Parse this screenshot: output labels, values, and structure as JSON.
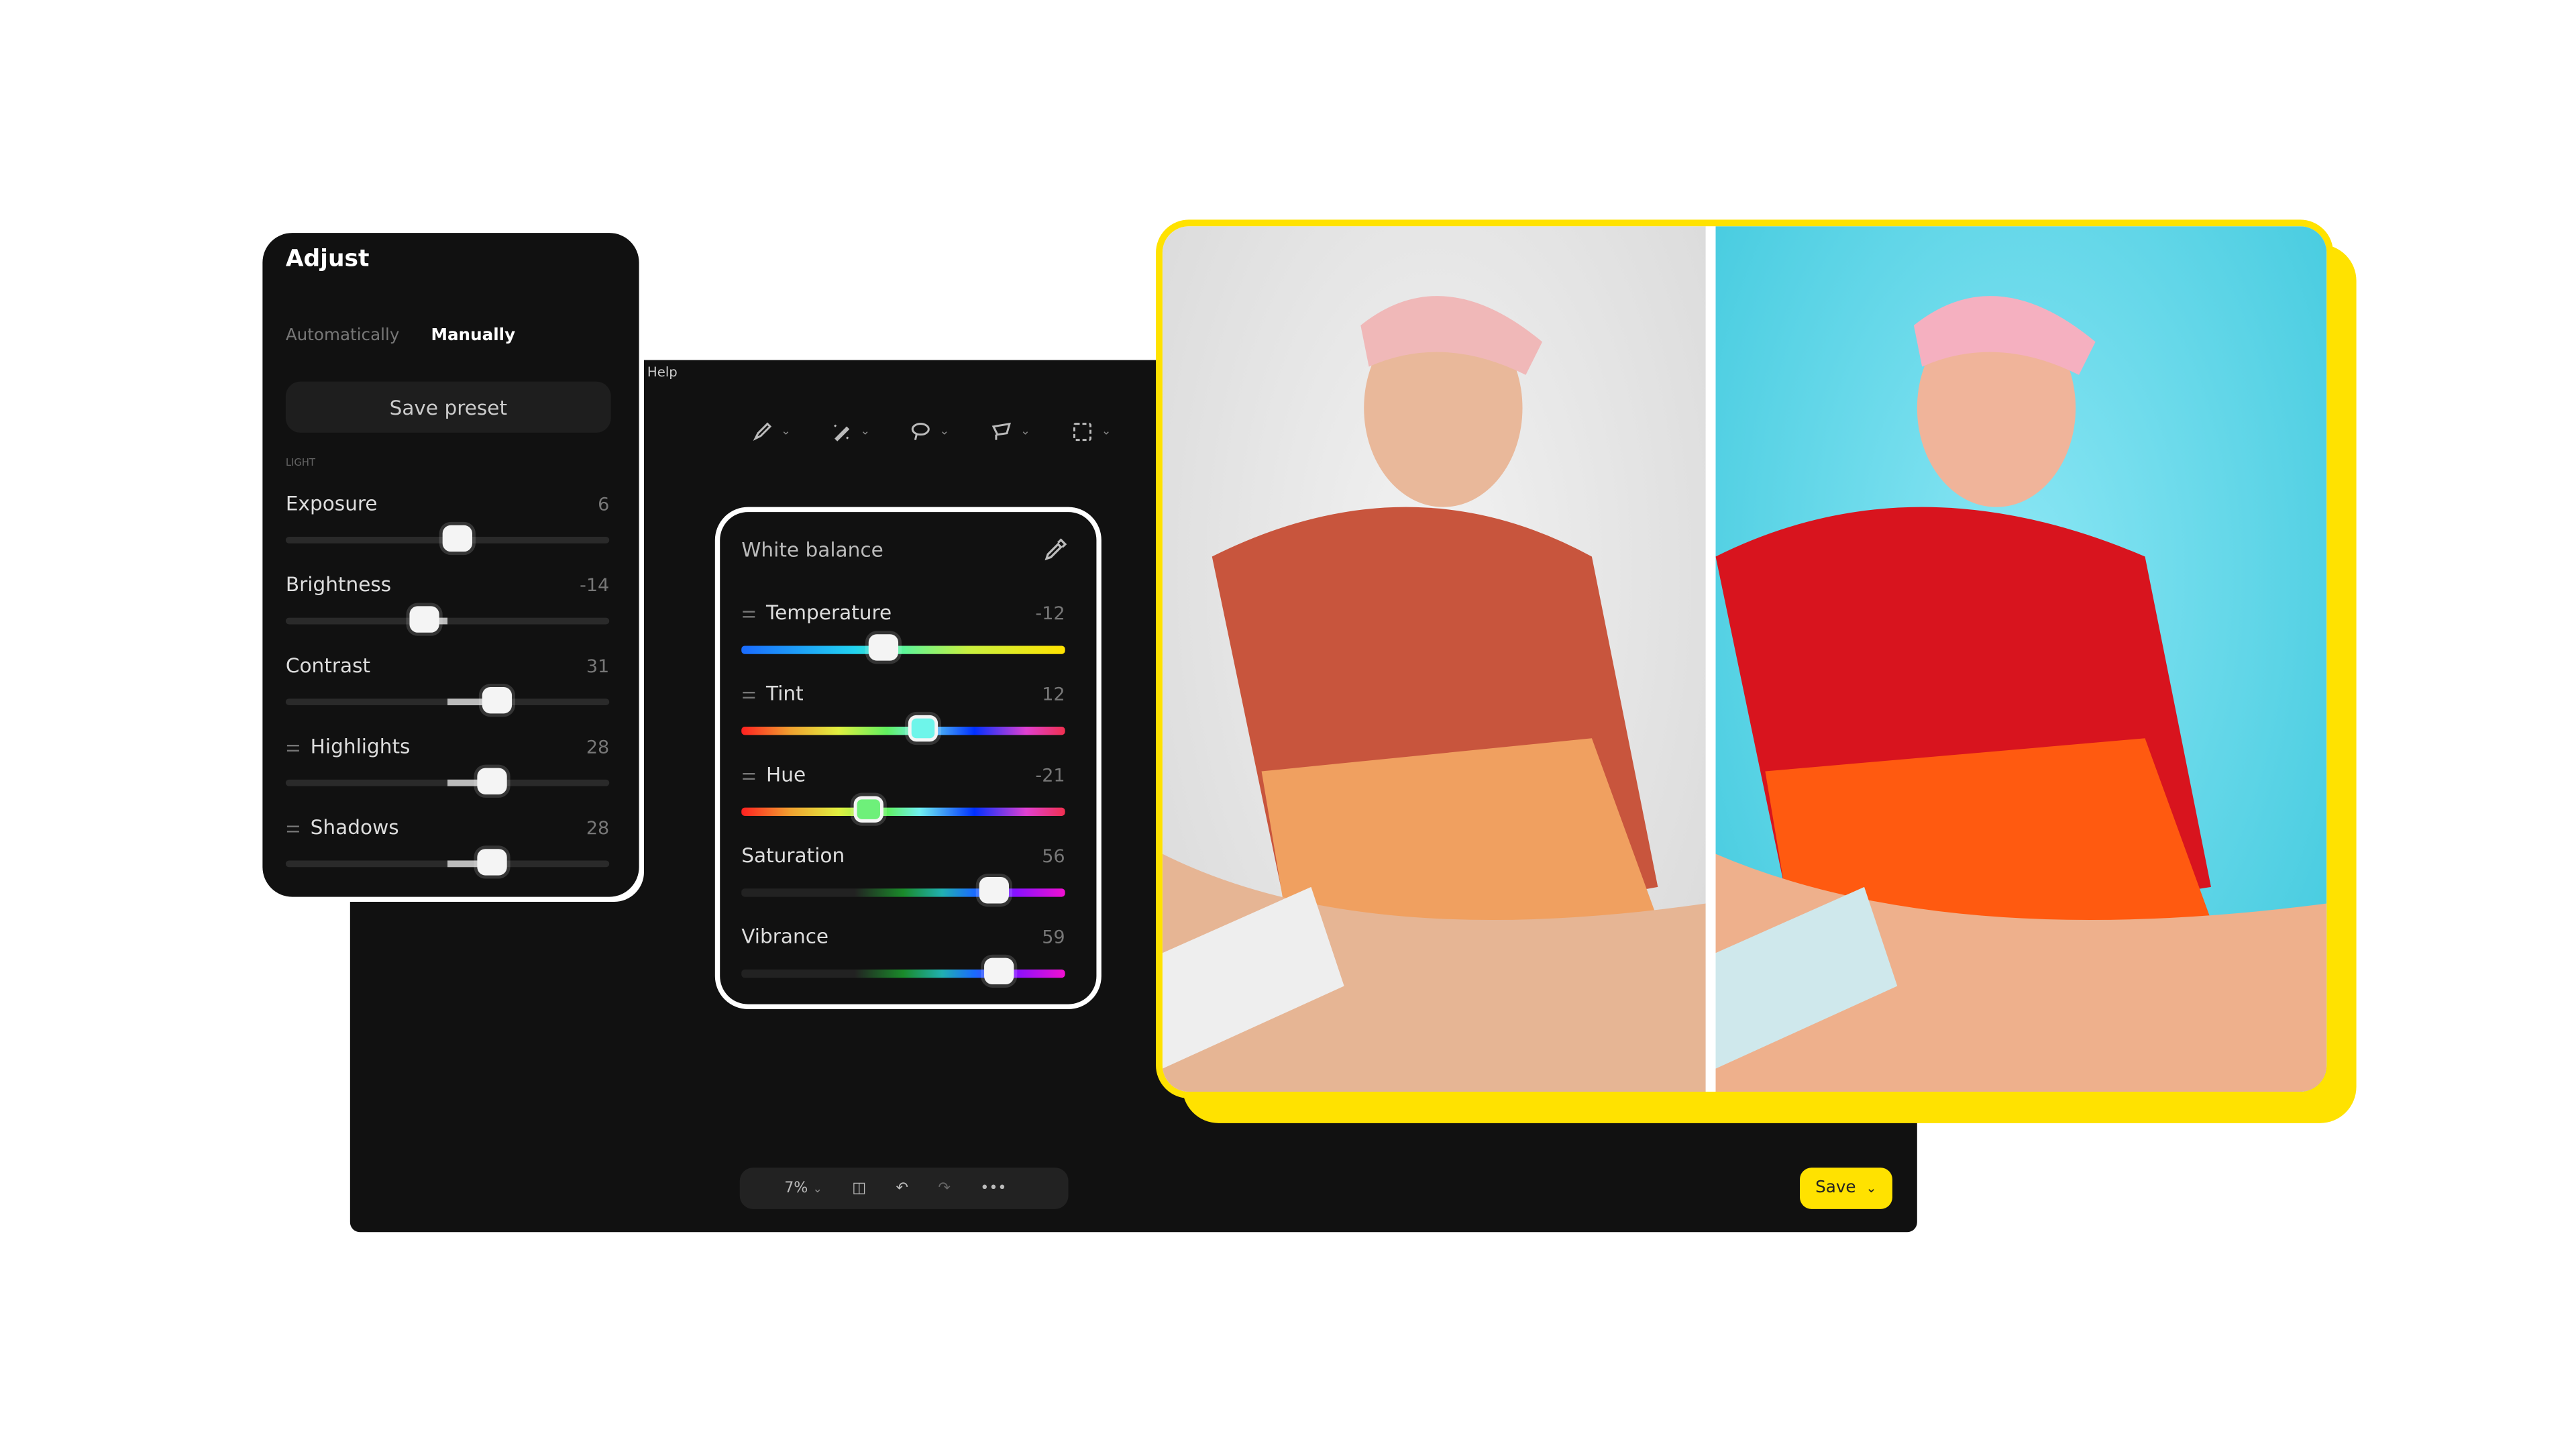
{
  "menu": {
    "help": "Help"
  },
  "toolbar": {
    "tools": [
      {
        "icon": "brush-icon"
      },
      {
        "icon": "magic-brush-icon"
      },
      {
        "icon": "lasso-icon"
      },
      {
        "icon": "polygon-lasso-icon"
      },
      {
        "icon": "rect-select-icon"
      }
    ]
  },
  "adjust": {
    "title": "Adjust",
    "modes": [
      "Automatically",
      "Manually"
    ],
    "active_mode": "Manually",
    "save_preset": "Save preset",
    "section": "LIGHT",
    "sliders": [
      {
        "label": "Exposure",
        "value": 6,
        "min": -100,
        "max": 100,
        "icon": false
      },
      {
        "label": "Brightness",
        "value": -14,
        "min": -100,
        "max": 100,
        "icon": false
      },
      {
        "label": "Contrast",
        "value": 31,
        "min": -100,
        "max": 100,
        "icon": false
      },
      {
        "label": "Highlights",
        "value": 28,
        "min": -100,
        "max": 100,
        "icon": true
      },
      {
        "label": "Shadows",
        "value": 28,
        "min": -100,
        "max": 100,
        "icon": true
      }
    ]
  },
  "white_balance": {
    "title": "White balance",
    "sliders": [
      {
        "label": "Temperature",
        "value": -12,
        "min": -100,
        "max": 100,
        "icon": true,
        "gradient": "linear-gradient(90deg,#1a6bff,#22d3f0 35%,#5cf59a 50%,#c8f040 70%,#ffe200)",
        "thumb": "#f4f4f4"
      },
      {
        "label": "Tint",
        "value": 12,
        "min": -100,
        "max": 100,
        "icon": true,
        "gradient": "linear-gradient(90deg,#ff2020,#f0a030 15%,#e0f040 30%,#60f060 45%,#70f0f0 55%,#0030ff 72%,#e040d0 88%,#f03050)",
        "thumb": "#6ef5ea"
      },
      {
        "label": "Hue",
        "value": -21,
        "min": -100,
        "max": 100,
        "icon": true,
        "gradient": "linear-gradient(90deg,#ff2020,#f0a030 15%,#e0f040 30%,#60f060 45%,#70f0f0 55%,#0030ff 72%,#e040d0 88%,#f03050)",
        "thumb": "#6ef07a"
      },
      {
        "label": "Saturation",
        "value": 56,
        "min": -100,
        "max": 100,
        "icon": false,
        "gradient": "linear-gradient(90deg,#222,#222 35%,#1a8a2a 50%,#20b0b0 62%,#1a6bff 72%,#8a10ff 85%,#f010d0)",
        "thumb": "#f4f4f4"
      },
      {
        "label": "Vibrance",
        "value": 59,
        "min": -100,
        "max": 100,
        "icon": false,
        "gradient": "linear-gradient(90deg,#222,#222 35%,#1a8a2a 50%,#20b0b0 62%,#1a6bff 72%,#8a10ff 85%,#f010d0)",
        "thumb": "#f4f4f4"
      }
    ]
  },
  "bottom_bar": {
    "zoom": "7%"
  },
  "save_button": "Save",
  "colors": {
    "accent": "#ffe200",
    "panel": "#111111"
  }
}
